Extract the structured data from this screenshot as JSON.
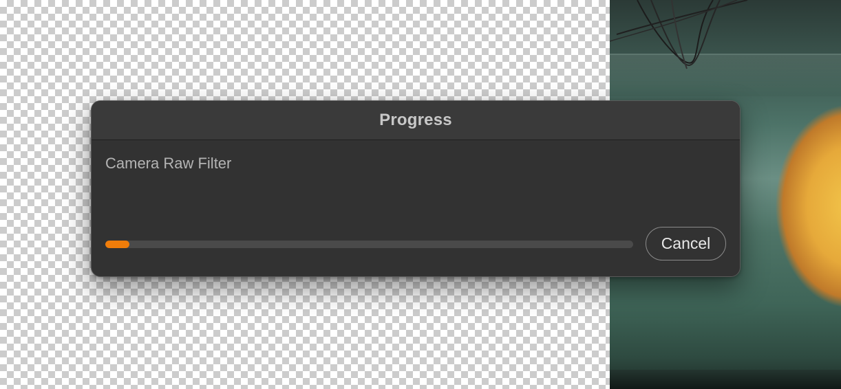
{
  "dialog": {
    "title": "Progress",
    "message": "Camera Raw Filter",
    "progress_fraction": 0.045,
    "cancel_label": "Cancel"
  },
  "colors": {
    "dialog_background": "#323232",
    "titlebar_background": "#3a3a3a",
    "progress_track": "#4a4a4a",
    "progress_fill": "#f07d0a",
    "button_border": "#8c8c8c"
  },
  "canvas": {
    "left_region": "transparency-checkerboard",
    "right_region": "photo"
  }
}
